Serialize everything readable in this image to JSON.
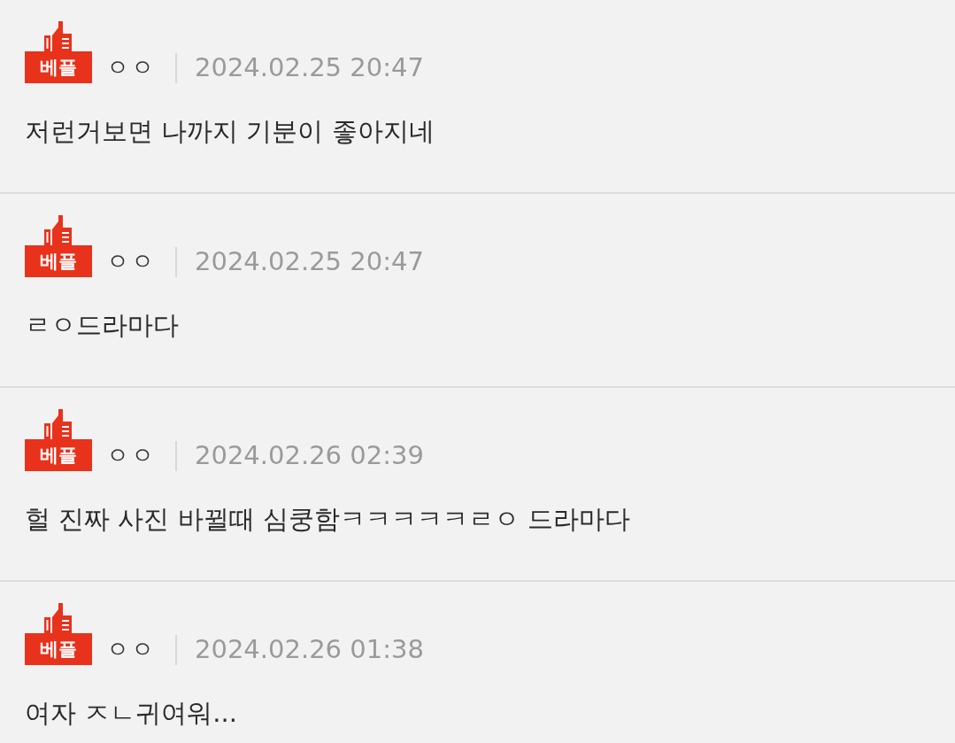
{
  "comments": [
    {
      "badge": "베플",
      "author": "ㅇㅇ",
      "date": "2024.02.25 20:47",
      "text": "저런거보면 나까지 기분이 좋아지네"
    },
    {
      "badge": "베플",
      "author": "ㅇㅇ",
      "date": "2024.02.25 20:47",
      "text": "ㄹㅇ드라마다"
    },
    {
      "badge": "베플",
      "author": "ㅇㅇ",
      "date": "2024.02.26 02:39",
      "text": "헐 진짜 사진 바뀔때 심쿵함ㅋㅋㅋㅋㅋㄹㅇ 드라마다"
    },
    {
      "badge": "베플",
      "author": "ㅇㅇ",
      "date": "2024.02.26 01:38",
      "text": "여자 ㅈㄴ귀여워..."
    }
  ]
}
